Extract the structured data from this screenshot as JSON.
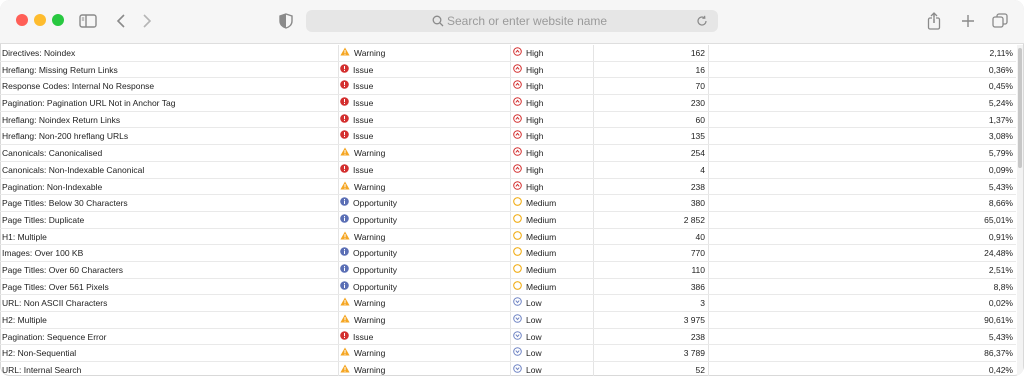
{
  "browser": {
    "address_placeholder": "Search or enter website name"
  },
  "rows": [
    {
      "name": "Directives: Noindex",
      "type": "Warning",
      "type_icon": "warning-icon",
      "priority": "High",
      "priority_icon": "high-priority-icon",
      "urls": "162",
      "pct": "2,11%"
    },
    {
      "name": "Hreflang: Missing Return Links",
      "type": "Issue",
      "type_icon": "issue-icon",
      "priority": "High",
      "priority_icon": "high-priority-icon",
      "urls": "16",
      "pct": "0,36%"
    },
    {
      "name": "Response Codes: Internal No Response",
      "type": "Issue",
      "type_icon": "issue-icon",
      "priority": "High",
      "priority_icon": "high-priority-icon",
      "urls": "70",
      "pct": "0,45%"
    },
    {
      "name": "Pagination: Pagination URL Not in Anchor Tag",
      "type": "Issue",
      "type_icon": "issue-icon",
      "priority": "High",
      "priority_icon": "high-priority-icon",
      "urls": "230",
      "pct": "5,24%"
    },
    {
      "name": "Hreflang: Noindex Return Links",
      "type": "Issue",
      "type_icon": "issue-icon",
      "priority": "High",
      "priority_icon": "high-priority-icon",
      "urls": "60",
      "pct": "1,37%"
    },
    {
      "name": "Hreflang: Non-200 hreflang URLs",
      "type": "Issue",
      "type_icon": "issue-icon",
      "priority": "High",
      "priority_icon": "high-priority-icon",
      "urls": "135",
      "pct": "3,08%"
    },
    {
      "name": "Canonicals: Canonicalised",
      "type": "Warning",
      "type_icon": "warning-icon",
      "priority": "High",
      "priority_icon": "high-priority-icon",
      "urls": "254",
      "pct": "5,79%"
    },
    {
      "name": "Canonicals: Non-Indexable Canonical",
      "type": "Issue",
      "type_icon": "issue-icon",
      "priority": "High",
      "priority_icon": "high-priority-icon",
      "urls": "4",
      "pct": "0,09%"
    },
    {
      "name": "Pagination: Non-Indexable",
      "type": "Warning",
      "type_icon": "warning-icon",
      "priority": "High",
      "priority_icon": "high-priority-icon",
      "urls": "238",
      "pct": "5,43%"
    },
    {
      "name": "Page Titles: Below 30 Characters",
      "type": "Opportunity",
      "type_icon": "opportunity-icon",
      "priority": "Medium",
      "priority_icon": "medium-priority-icon",
      "urls": "380",
      "pct": "8,66%"
    },
    {
      "name": "Page Titles: Duplicate",
      "type": "Opportunity",
      "type_icon": "opportunity-icon",
      "priority": "Medium",
      "priority_icon": "medium-priority-icon",
      "urls": "2 852",
      "pct": "65,01%"
    },
    {
      "name": "H1: Multiple",
      "type": "Warning",
      "type_icon": "warning-icon",
      "priority": "Medium",
      "priority_icon": "medium-priority-icon",
      "urls": "40",
      "pct": "0,91%"
    },
    {
      "name": "Images: Over 100 KB",
      "type": "Opportunity",
      "type_icon": "opportunity-icon",
      "priority": "Medium",
      "priority_icon": "medium-priority-icon",
      "urls": "770",
      "pct": "24,48%"
    },
    {
      "name": "Page Titles: Over 60 Characters",
      "type": "Opportunity",
      "type_icon": "opportunity-icon",
      "priority": "Medium",
      "priority_icon": "medium-priority-icon",
      "urls": "110",
      "pct": "2,51%"
    },
    {
      "name": "Page Titles: Over 561 Pixels",
      "type": "Opportunity",
      "type_icon": "opportunity-icon",
      "priority": "Medium",
      "priority_icon": "medium-priority-icon",
      "urls": "386",
      "pct": "8,8%"
    },
    {
      "name": "URL: Non ASCII Characters",
      "type": "Warning",
      "type_icon": "warning-icon",
      "priority": "Low",
      "priority_icon": "low-priority-icon",
      "urls": "3",
      "pct": "0,02%"
    },
    {
      "name": "H2: Multiple",
      "type": "Warning",
      "type_icon": "warning-icon",
      "priority": "Low",
      "priority_icon": "low-priority-icon",
      "urls": "3 975",
      "pct": "90,61%"
    },
    {
      "name": "Pagination: Sequence Error",
      "type": "Issue",
      "type_icon": "issue-icon",
      "priority": "Low",
      "priority_icon": "low-priority-icon",
      "urls": "238",
      "pct": "5,43%"
    },
    {
      "name": "H2: Non-Sequential",
      "type": "Warning",
      "type_icon": "warning-icon",
      "priority": "Low",
      "priority_icon": "low-priority-icon",
      "urls": "3 789",
      "pct": "86,37%"
    },
    {
      "name": "URL: Internal Search",
      "type": "Warning",
      "type_icon": "warning-icon",
      "priority": "Low",
      "priority_icon": "low-priority-icon",
      "urls": "52",
      "pct": "0,42%"
    }
  ],
  "colors": {
    "issue": "#d32f2f",
    "warning": "#f5a623",
    "opportunity": "#5b6fb5",
    "high": "#d32f2f",
    "medium": "#f2b01e",
    "low": "#6f84c4"
  }
}
